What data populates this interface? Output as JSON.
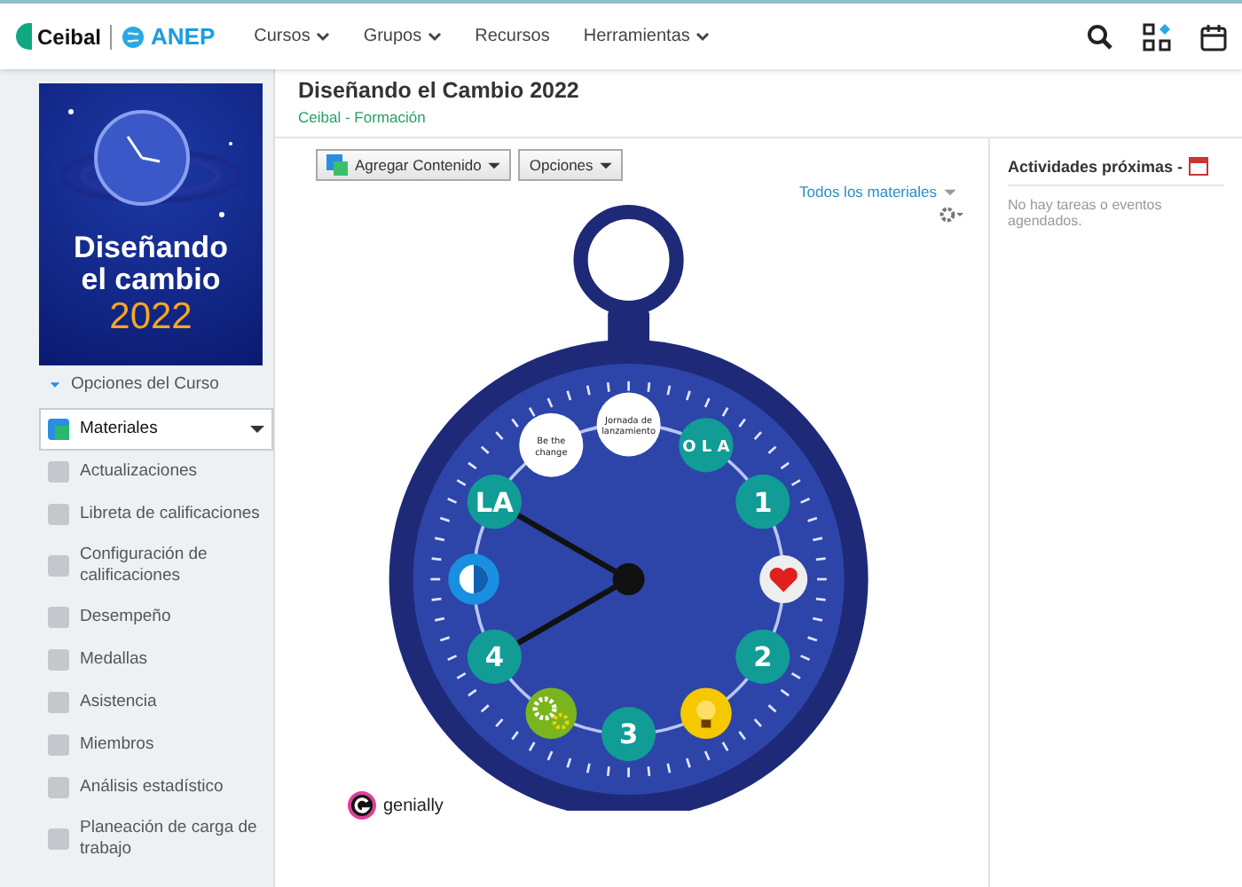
{
  "topbar": {
    "logo": {
      "brand": "Ceibal",
      "partner": "ANEP"
    },
    "menu": [
      {
        "label": "Cursos",
        "dropdown": true
      },
      {
        "label": "Grupos",
        "dropdown": true
      },
      {
        "label": "Recursos",
        "dropdown": false
      },
      {
        "label": "Herramientas",
        "dropdown": true
      }
    ]
  },
  "sidebar": {
    "course_image": {
      "title_line_1": "Diseñando",
      "title_line_2": "el cambio",
      "year": "2022"
    },
    "options_label": "Opciones del Curso",
    "items": [
      {
        "label": "Materiales",
        "selected": true
      },
      {
        "label": "Actualizaciones",
        "selected": false
      },
      {
        "label": "Libreta de calificaciones",
        "selected": false
      },
      {
        "label": "Configuración de calificaciones",
        "selected": false
      },
      {
        "label": "Desempeño",
        "selected": false
      },
      {
        "label": "Medallas",
        "selected": false
      },
      {
        "label": "Asistencia",
        "selected": false
      },
      {
        "label": "Miembros",
        "selected": false
      },
      {
        "label": "Análisis estadístico",
        "selected": false
      },
      {
        "label": "Planeación de carga de trabajo",
        "selected": false
      }
    ]
  },
  "course": {
    "title": "Diseñando el Cambio 2022",
    "breadcrumb": "Ceibal - Formación"
  },
  "toolbar": {
    "buttons": [
      "Agregar Contenido",
      "Opciones"
    ],
    "filter": "Todos los materiales"
  },
  "clock": {
    "markers": [
      {
        "kind": "text",
        "label": "Jornada de lanzamiento"
      },
      {
        "kind": "text",
        "label": "O L A"
      },
      {
        "kind": "text",
        "label": "1"
      },
      {
        "kind": "heart"
      },
      {
        "kind": "text",
        "label": "2"
      },
      {
        "kind": "bulb"
      },
      {
        "kind": "text",
        "label": "3"
      },
      {
        "kind": "gears"
      },
      {
        "kind": "text",
        "label": "4"
      },
      {
        "kind": "halfmoon"
      },
      {
        "kind": "text",
        "label": "LA"
      },
      {
        "kind": "text",
        "label": "Be the change"
      }
    ],
    "brand": "genially"
  },
  "upcoming": {
    "title": "Actividades próximas -",
    "empty": "No hay tareas o eventos agendados."
  }
}
